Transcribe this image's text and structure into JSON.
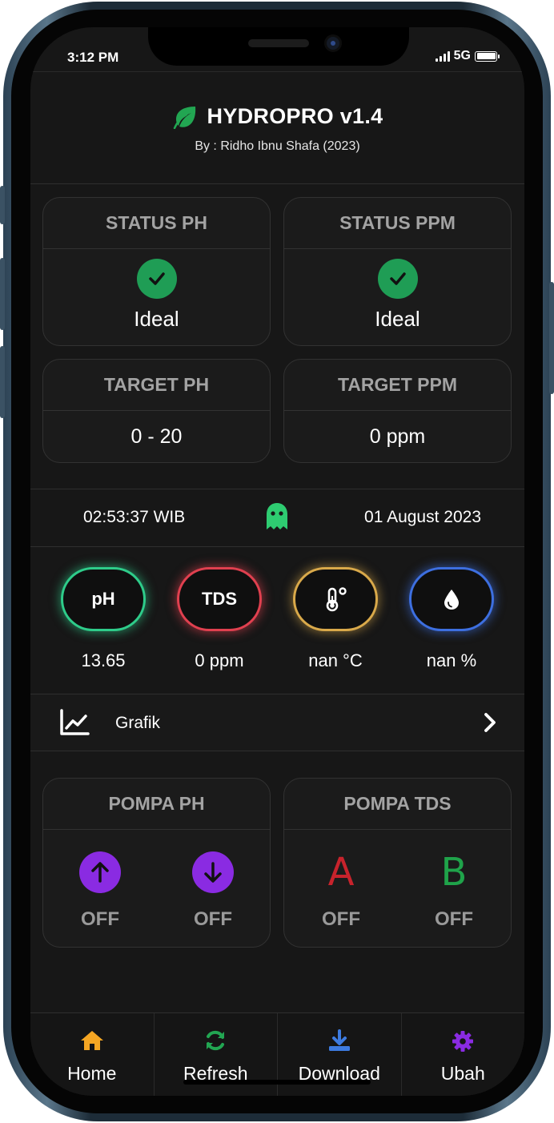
{
  "status_bar": {
    "time": "3:12 PM",
    "network": "5G"
  },
  "header": {
    "title": "HYDROPRO v1.4",
    "subtitle": "By : Ridho Ibnu Shafa (2023)"
  },
  "status_cards": [
    {
      "title": "STATUS PH",
      "value": "Ideal"
    },
    {
      "title": "STATUS PPM",
      "value": "Ideal"
    }
  ],
  "target_cards": [
    {
      "title": "TARGET PH",
      "value": "0 - 20"
    },
    {
      "title": "TARGET PPM",
      "value": "0 ppm"
    }
  ],
  "clock": {
    "time": "02:53:37 WIB",
    "date": "01 August 2023"
  },
  "sensors": [
    {
      "label": "pH",
      "value": "13.65",
      "color": "#2ecc8a"
    },
    {
      "label": "TDS",
      "value": "0 ppm",
      "color": "#e0404f"
    },
    {
      "label": "",
      "icon": "thermometer-icon",
      "value": "nan °C",
      "color": "#d9a94a"
    },
    {
      "label": "",
      "icon": "water-drop-icon",
      "value": "nan %",
      "color": "#3d6fe0"
    }
  ],
  "grafik": {
    "label": "Grafik"
  },
  "pumps": {
    "ph": {
      "title": "POMPA PH",
      "up_state": "OFF",
      "down_state": "OFF"
    },
    "tds": {
      "title": "POMPA TDS",
      "a_letter": "A",
      "b_letter": "B",
      "a_state": "OFF",
      "b_state": "OFF"
    }
  },
  "bottom_nav": [
    {
      "label": "Home",
      "icon": "home-icon",
      "color": "#f5a623"
    },
    {
      "label": "Refresh",
      "icon": "refresh-icon",
      "color": "#22a652"
    },
    {
      "label": "Download",
      "icon": "download-icon",
      "color": "#3d7be0"
    },
    {
      "label": "Ubah",
      "icon": "gear-icon",
      "color": "#8a2be2"
    }
  ],
  "colors": {
    "background": "#171717",
    "card": "#1b1b1b",
    "success": "#1f9d55",
    "accent_purple": "#8a2be2"
  }
}
